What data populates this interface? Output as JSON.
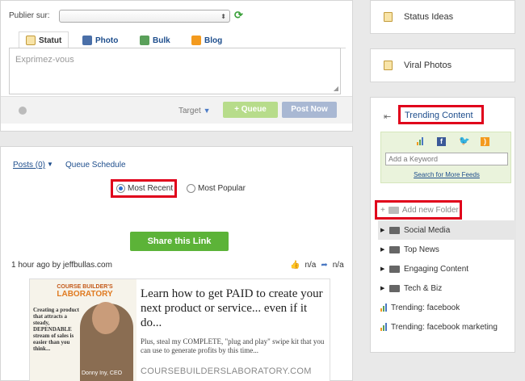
{
  "compose": {
    "publish_label": "Publier sur:",
    "publish_value": "",
    "tabs": [
      {
        "label": "Statut",
        "icon": "status-icon"
      },
      {
        "label": "Photo",
        "icon": "photo-icon"
      },
      {
        "label": "Bulk",
        "icon": "bulk-icon"
      },
      {
        "label": "Blog",
        "icon": "rss-icon"
      }
    ],
    "placeholder": "Exprimez-vous",
    "target_label": "Target",
    "queue_button": "+ Queue",
    "post_now_button": "Post Now"
  },
  "feed": {
    "posts_link": "Posts (0)",
    "queue_schedule": "Queue Schedule",
    "radio_most_recent": "Most Recent",
    "radio_most_popular": "Most Popular",
    "share_button": "Share this Link",
    "post_meta": "1 hour ago by jeffbullas.com",
    "likes": "n/a",
    "shares": "n/a",
    "ad": {
      "logo_top": "COURSE BUILDER'S",
      "logo_bottom": "LABORATORY",
      "quote": "Creating a product that attracts a steady, DEPENDABLE stream of sales is easier than you think...",
      "caption": "Donny Iny, CEO",
      "headline": "Learn how to get PAID to create your next product or service... even if it do...",
      "subtext": "Plus, steal my COMPLETE, \"plug and play\" swipe kit that you can use to generate profits by this time...",
      "url": "COURSEBUILDERSLABORATORY.COM"
    }
  },
  "sidebar": {
    "status_ideas": "Status Ideas",
    "viral_photos": "Viral Photos",
    "trending_title": "Trending Content",
    "keyword_placeholder": "Add a Keyword",
    "search_more": "Search for More Feeds",
    "add_folder": "Add new Folder",
    "folders": [
      {
        "label": "Social Media",
        "type": "folder"
      },
      {
        "label": "Top News",
        "type": "folder"
      },
      {
        "label": "Engaging Content",
        "type": "folder"
      },
      {
        "label": "Tech & Biz",
        "type": "folder"
      },
      {
        "label": "Trending: facebook",
        "type": "trend"
      },
      {
        "label": "Trending: facebook marketing",
        "type": "trend"
      }
    ]
  },
  "colors": {
    "highlight": "#e0001b",
    "share_green": "#5cb338",
    "link_blue": "#1d4d8c"
  }
}
